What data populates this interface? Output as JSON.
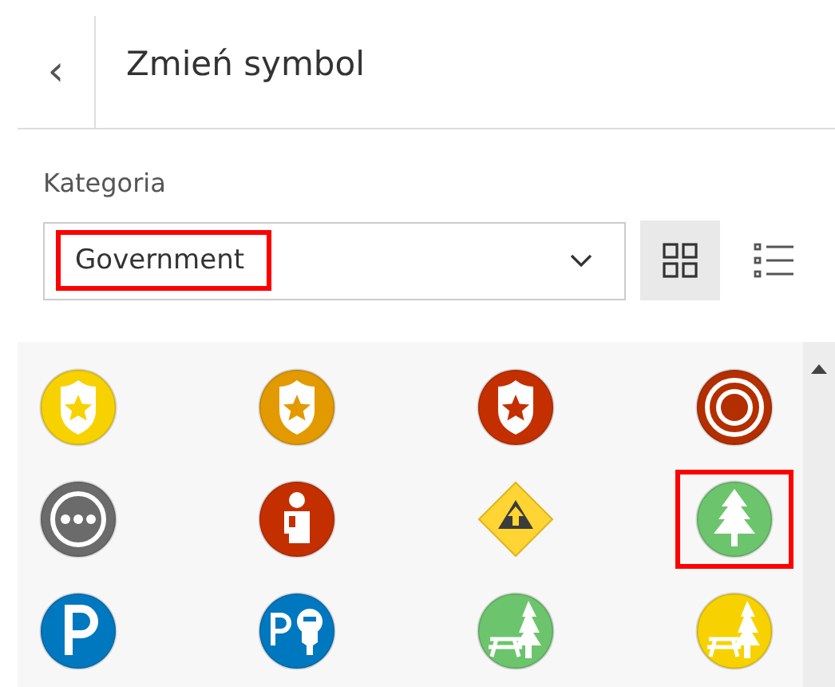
{
  "header": {
    "back": "‹",
    "title": "Zmień symbol"
  },
  "category": {
    "label": "Kategoria",
    "value": "Government",
    "highlighted": true
  },
  "view_toggle": [
    {
      "kind": "grid",
      "selected": true
    },
    {
      "kind": "list",
      "selected": false
    }
  ],
  "symbols": [
    {
      "kind": "shield",
      "color": "#f7d200",
      "selected": false
    },
    {
      "kind": "shield",
      "color": "#e39a00",
      "selected": false
    },
    {
      "kind": "shield",
      "color": "#c42f00",
      "selected": false
    },
    {
      "kind": "target",
      "color": "#b42f00",
      "selected": false
    },
    {
      "kind": "more",
      "color": "#6b6b6b",
      "selected": false
    },
    {
      "kind": "person",
      "color": "#c42f00",
      "selected": false
    },
    {
      "kind": "diamond",
      "color": "#ffd433",
      "selected": false
    },
    {
      "kind": "tree",
      "color": "#6cc46c",
      "selected": true
    },
    {
      "kind": "parking",
      "color": "#0078c0",
      "selected": false
    },
    {
      "kind": "meter",
      "color": "#0078c0",
      "selected": false
    },
    {
      "kind": "picnic",
      "color": "#6cc46c",
      "selected": false
    },
    {
      "kind": "picnic",
      "color": "#f7d200",
      "selected": false
    }
  ]
}
